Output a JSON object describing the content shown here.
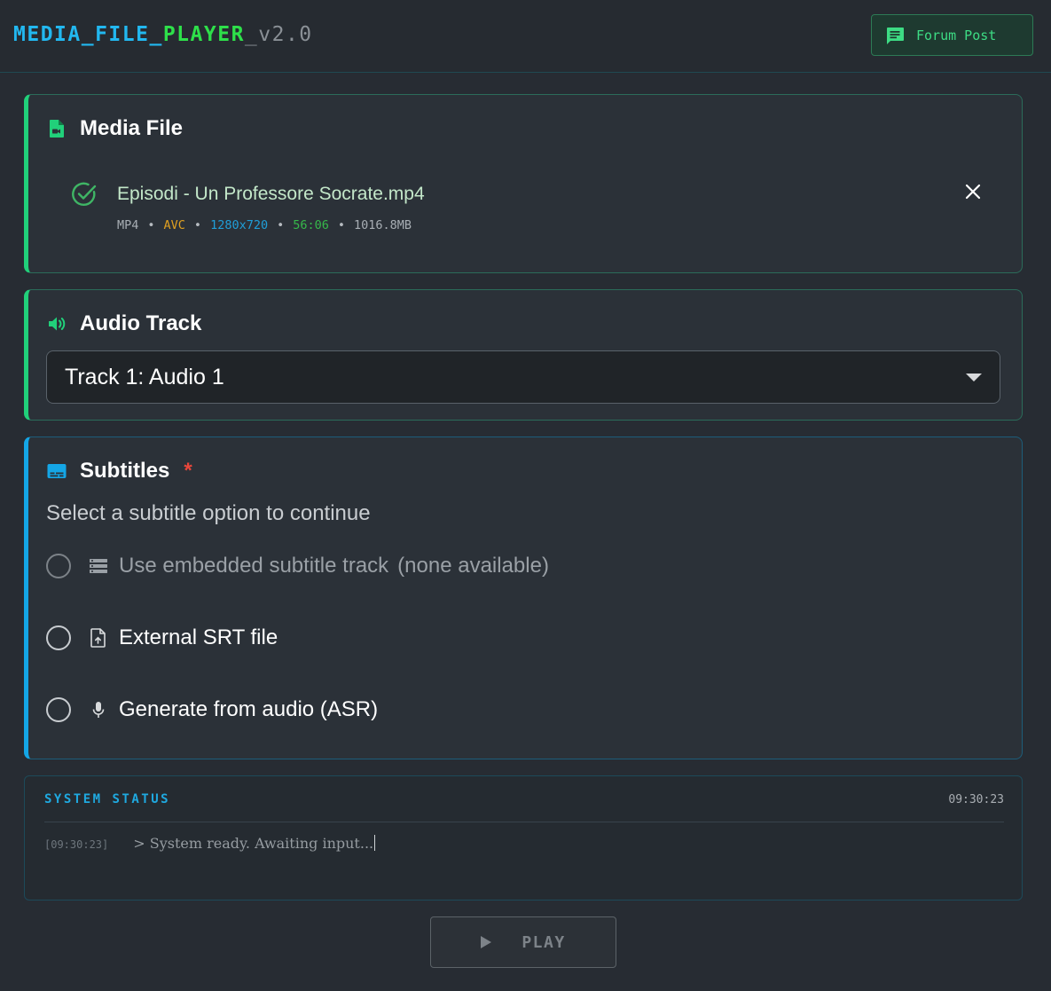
{
  "header": {
    "logo_part1": "MEDIA_FILE_",
    "logo_part2": "PLAYER",
    "logo_version": "_v2.0",
    "forum_label": "Forum Post"
  },
  "media_file": {
    "title": "Media File",
    "file_name": "Episodi - Un Professore Socrate.mp4",
    "meta": {
      "container": "MP4",
      "codec": "AVC",
      "resolution": "1280x720",
      "duration": "56:06",
      "size": "1016.8MB",
      "separator": "•"
    }
  },
  "audio_track": {
    "title": "Audio Track",
    "selected": "Track 1: Audio 1"
  },
  "subtitles": {
    "title": "Subtitles",
    "required_mark": "*",
    "hint": "Select a subtitle option to continue",
    "options": [
      {
        "label": "Use embedded subtitle track",
        "extra": "(none available)",
        "disabled": true
      },
      {
        "label": "External SRT file",
        "extra": "",
        "disabled": false
      },
      {
        "label": "Generate from audio (ASR)",
        "extra": "",
        "disabled": false
      }
    ]
  },
  "status": {
    "title": "SYSTEM STATUS",
    "time": "09:30:23",
    "log": [
      {
        "time": "[09:30:23]",
        "message": "> System ready. Awaiting input..."
      }
    ]
  },
  "play": {
    "label": "PLAY",
    "enabled": false
  },
  "colors": {
    "accent_green": "#21d07a",
    "accent_blue": "#14a6e6",
    "codec": "#e0a020",
    "resolution": "#1f9ed8",
    "duration": "#36b84a",
    "required": "#e9473b"
  }
}
